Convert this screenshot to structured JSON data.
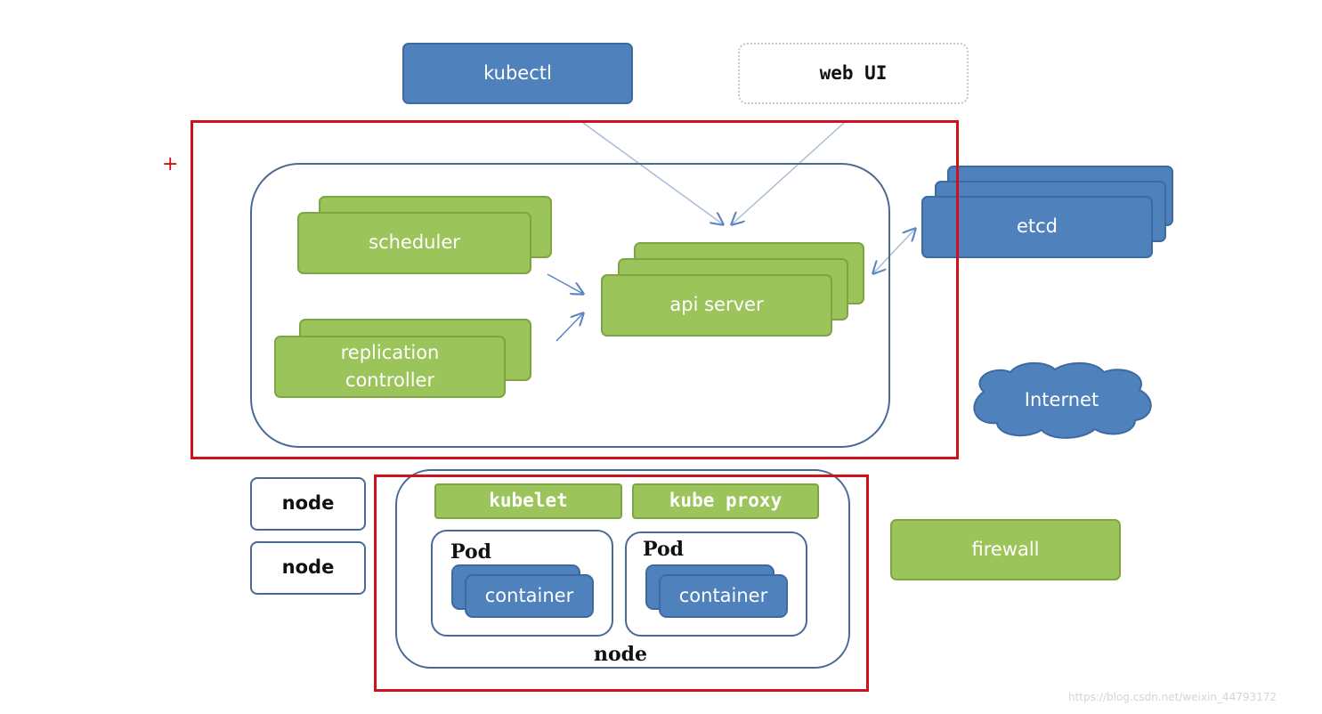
{
  "diagram": {
    "client": {
      "kubectl": "kubectl",
      "web_ui": "web UI"
    },
    "master": {
      "scheduler": "scheduler",
      "replication_controller": "replication controller",
      "api_server": "api server"
    },
    "etcd": "etcd",
    "internet": "Internet",
    "firewall": "firewall",
    "nodes": {
      "node_1": "node",
      "node_2": "node",
      "node_main": "node"
    },
    "node_components": {
      "kubelet": "kubelet",
      "kube_proxy": "kube proxy"
    },
    "pods": [
      {
        "label": "Pod",
        "container": "container"
      },
      {
        "label": "Pod",
        "container": "container"
      }
    ],
    "marker": "+",
    "watermark": "https://blog.csdn.net/weixin_44793172"
  },
  "colors": {
    "green": "#9bc45a",
    "blue": "#4f81bd",
    "highlight_red": "#d0101a",
    "outline": "#4a6a94"
  }
}
